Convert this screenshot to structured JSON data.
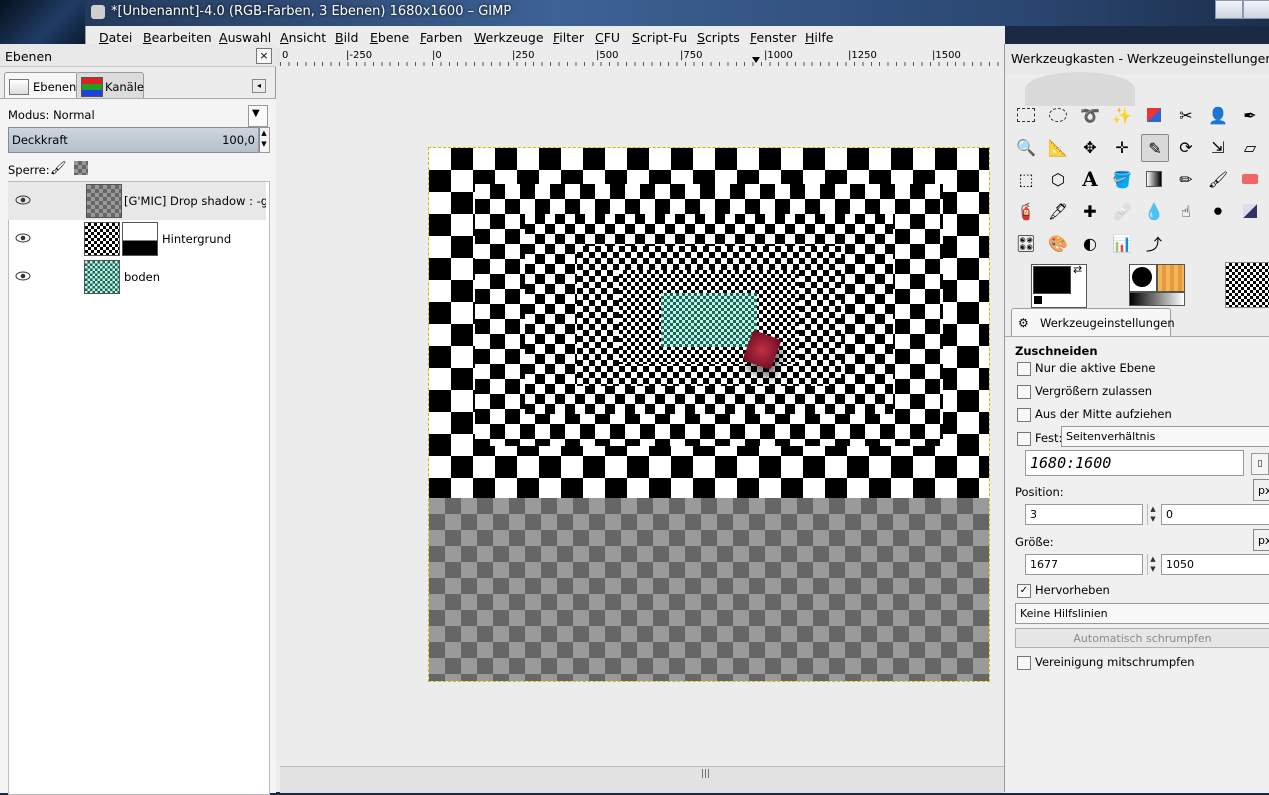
{
  "window": {
    "title": "*[Unbenannt]-4.0 (RGB-Farben, 3 Ebenen) 1680x1600 – GIMP"
  },
  "menubar": {
    "items": [
      "Datei",
      "Bearbeiten",
      "Auswahl",
      "Ansicht",
      "Bild",
      "Ebene",
      "Farben",
      "Werkzeuge",
      "Filter",
      "CFU",
      "Script-Fu",
      "Scripts",
      "Fenster",
      "Hilfe"
    ]
  },
  "ruler": {
    "labels": [
      "0",
      "|-250",
      "|0",
      "|250",
      "|500",
      "|750",
      "|1000",
      "|1250",
      "|1500"
    ]
  },
  "layers_dock": {
    "title": "Ebenen",
    "tabs": [
      "Ebenen",
      "Kanäle"
    ],
    "mode_label": "Modus: Normal",
    "opacity_label": "Deckkraft",
    "opacity_value": "100,0",
    "lock_label": "Sperre:",
    "layers": [
      {
        "name": "[G'MIC] Drop shadow : -gimp_drop_shadow"
      },
      {
        "name": "Hintergrund"
      },
      {
        "name": "boden"
      }
    ]
  },
  "tool_dock": {
    "title": "Werkzeugkasten - Werkzeugeinstellungen",
    "options_tab": "Werkzeugeinstellungen",
    "tool_name": "Zuschneiden",
    "options": {
      "only_active_layer": "Nur die aktive Ebene",
      "allow_growing": "Vergrößern zulassen",
      "expand_from_center": "Aus der Mitte aufziehen",
      "fixed_label": "Fest:",
      "fixed_mode": "Seitenverhältnis",
      "ratio_value": "1680:1600",
      "position_label": "Position:",
      "position_x": "3",
      "position_y": "0",
      "size_label": "Größe:",
      "size_w": "1677",
      "size_h": "1050",
      "unit": "px",
      "highlight": "Hervorheben",
      "guides": "Keine Hilfslinien",
      "auto_shrink": "Automatisch schrumpfen",
      "shrink_merged": "Vereinigung mitschrumpfen"
    },
    "checkbox_states": {
      "only_active_layer": false,
      "allow_growing": false,
      "expand_from_center": false,
      "fixed": false,
      "highlight": true,
      "shrink_merged": false
    }
  },
  "colors": {
    "accent_titlebar": "#3d6295",
    "selection_dash": "#c8c000",
    "deck_bar": "#b3c0cb"
  }
}
